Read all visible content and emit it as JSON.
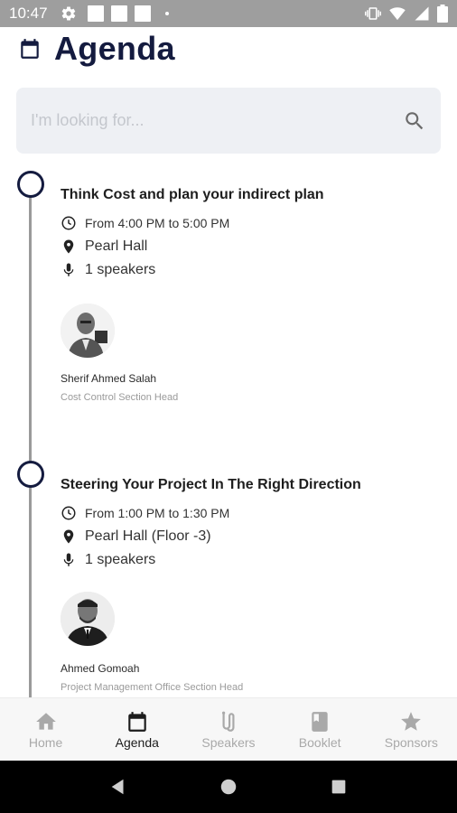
{
  "status_bar": {
    "time": "10:47",
    "icons": [
      "settings-icon",
      "notification-square-icon",
      "notification-square-icon",
      "notification-square-icon",
      "dot-icon",
      "vibrate-icon",
      "wifi-icon",
      "signal-icon",
      "battery-icon"
    ]
  },
  "header": {
    "icon": "calendar-icon",
    "title": "Agenda",
    "accent_color": "#141b3f"
  },
  "search": {
    "placeholder": "I'm looking for...",
    "value": "",
    "icon": "search-icon"
  },
  "sessions": [
    {
      "title": "Think Cost and plan your indirect plan",
      "time": "From 4:00 PM to 5:00 PM",
      "location": "Pearl Hall",
      "speakers_count": "1 speakers",
      "speakers": [
        {
          "name": "Sherif Ahmed Salah",
          "role": "Cost Control Section Head"
        }
      ]
    },
    {
      "title": "Steering Your Project In The Right Direction",
      "time": "From 1:00 PM to 1:30 PM",
      "location": "Pearl Hall (Floor -3)",
      "speakers_count": "1 speakers",
      "speakers": [
        {
          "name": "Ahmed Gomoah",
          "role": "Project Management Office Section Head"
        }
      ]
    }
  ],
  "bottom_nav": {
    "items": [
      {
        "label": "Home",
        "icon": "home-icon",
        "active": false
      },
      {
        "label": "Agenda",
        "icon": "calendar-icon",
        "active": true
      },
      {
        "label": "Speakers",
        "icon": "speakers-icon",
        "active": false
      },
      {
        "label": "Booklet",
        "icon": "book-icon",
        "active": false
      },
      {
        "label": "Sponsors",
        "icon": "star-icon",
        "active": false
      }
    ]
  },
  "system_nav": [
    "back-icon",
    "home-circle-icon",
    "recents-icon"
  ]
}
